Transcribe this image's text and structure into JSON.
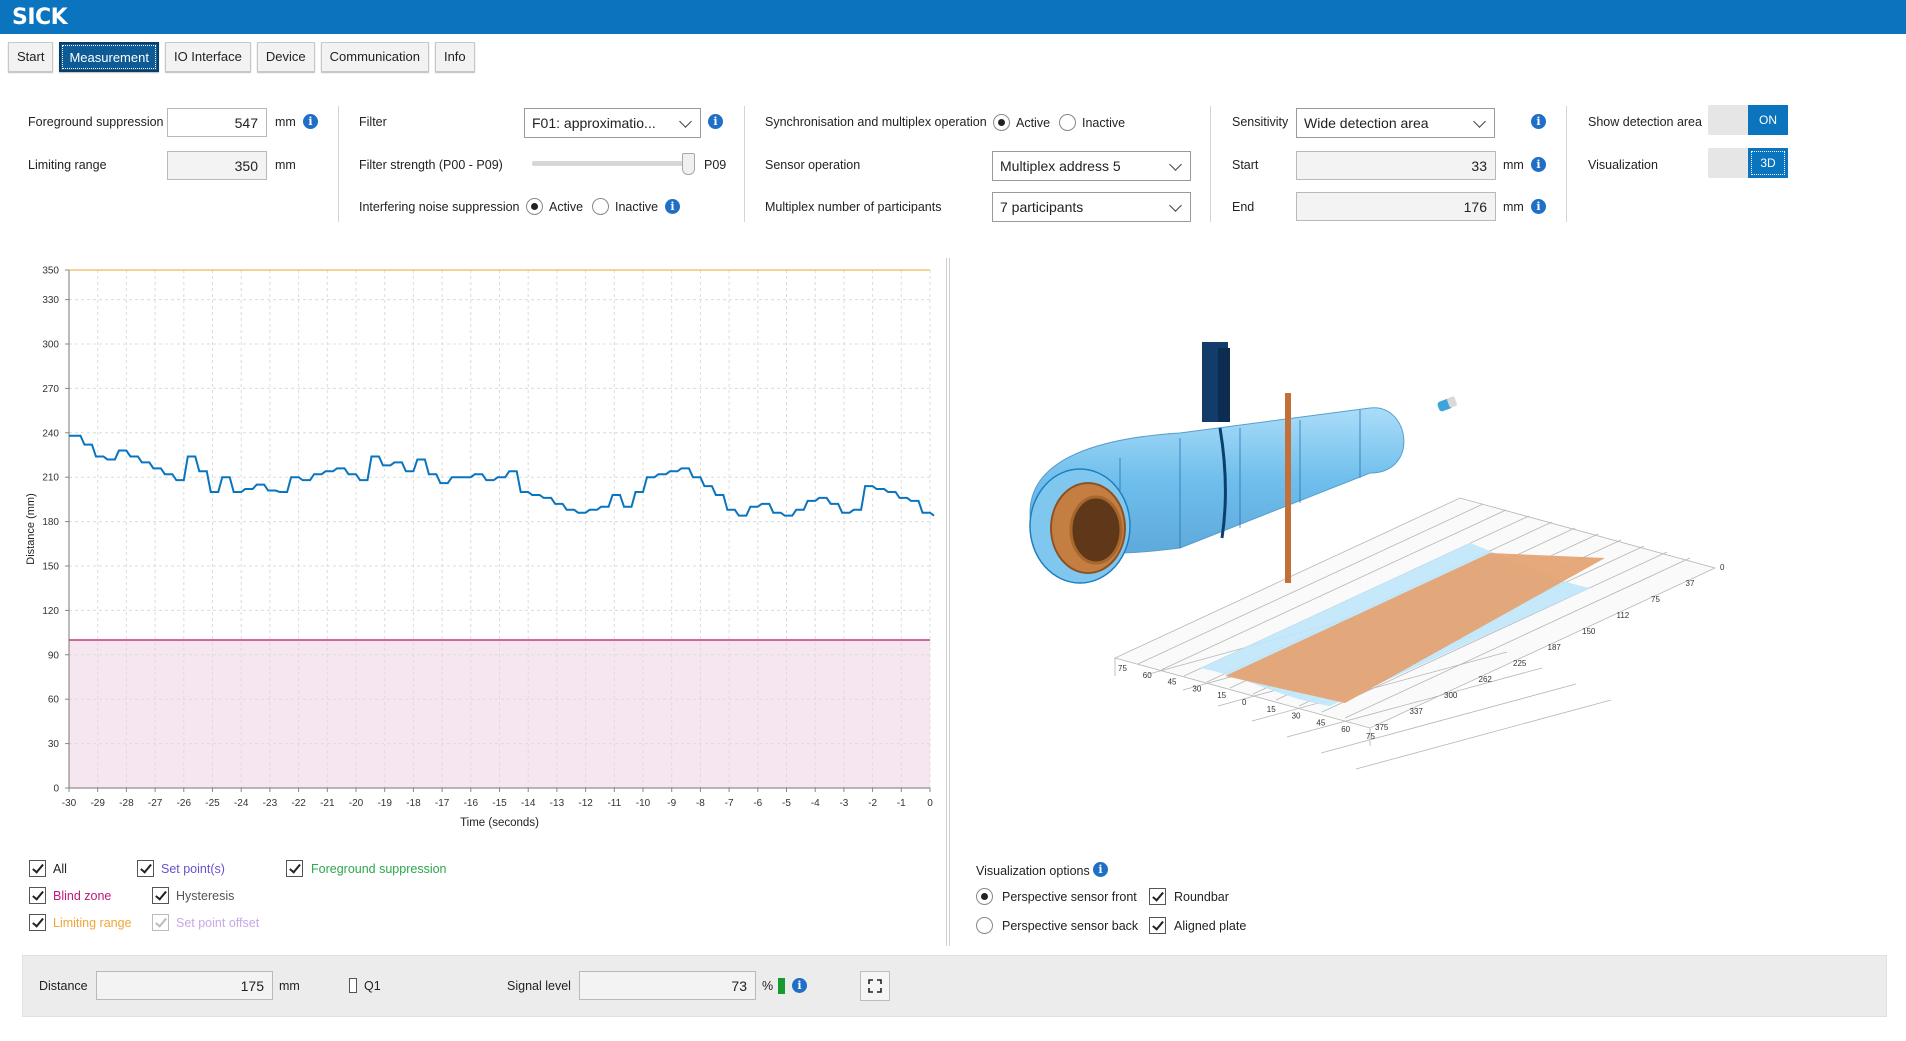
{
  "app": {
    "logo": "SICK"
  },
  "tabs": [
    {
      "label": "Start",
      "active": false
    },
    {
      "label": "Measurement",
      "active": true
    },
    {
      "label": "IO Interface",
      "active": false
    },
    {
      "label": "Device",
      "active": false
    },
    {
      "label": "Communication",
      "active": false
    },
    {
      "label": "Info",
      "active": false
    }
  ],
  "settings": {
    "foreground_suppression": {
      "label": "Foreground suppression",
      "value": "547",
      "unit": "mm"
    },
    "limiting_range": {
      "label": "Limiting range",
      "value": "350",
      "unit": "mm"
    },
    "filter": {
      "label": "Filter",
      "value": "F01: approximatio..."
    },
    "filter_strength": {
      "label": "Filter strength (P00 - P09)",
      "value_label": "P09",
      "level": 1.0
    },
    "interfering_noise": {
      "label": "Interfering noise suppression",
      "active_label": "Active",
      "inactive_label": "Inactive",
      "selected": "Active"
    },
    "sync_multiplex": {
      "label": "Synchronisation and multiplex operation",
      "active_label": "Active",
      "inactive_label": "Inactive",
      "selected": "Active"
    },
    "sensor_operation": {
      "label": "Sensor operation",
      "value": "Multiplex address 5"
    },
    "multiplex_participants": {
      "label": "Multiplex number of participants",
      "value": "7 participants"
    },
    "sensitivity": {
      "label": "Sensitivity",
      "value": "Wide detection area"
    },
    "start": {
      "label": "Start",
      "value": "33",
      "unit": "mm"
    },
    "end": {
      "label": "End",
      "value": "176",
      "unit": "mm"
    },
    "show_detection_area": {
      "label": "Show detection area",
      "value": "ON"
    },
    "visualization": {
      "label": "Visualization",
      "value": "3D"
    }
  },
  "chart_data": {
    "type": "line",
    "xlabel": "Time (seconds)",
    "ylabel": "Distance (mm)",
    "xlim": [
      -30,
      0
    ],
    "ylim": [
      0,
      350
    ],
    "x_ticks": [
      "-30",
      "-29",
      "-28",
      "-27",
      "-26",
      "-25",
      "-24",
      "-23",
      "-22",
      "-21",
      "-20",
      "-19",
      "-18",
      "-17",
      "-16",
      "-15",
      "-14",
      "-13",
      "-12",
      "-11",
      "-10",
      "-9",
      "-8",
      "-7",
      "-6",
      "-5",
      "-4",
      "-3",
      "-2",
      "-1",
      "0"
    ],
    "y_ticks": [
      "0",
      "30",
      "60",
      "90",
      "120",
      "150",
      "180",
      "210",
      "240",
      "270",
      "300",
      "330",
      "350"
    ],
    "grid": true,
    "series": [
      {
        "color": "#0a74bf",
        "x": [
          -30,
          -29.6,
          -29.2,
          -28.8,
          -28.4,
          -28,
          -27.6,
          -27.2,
          -26.8,
          -26.4,
          -26,
          -25.6,
          -25.2,
          -24.8,
          -24.4,
          -24,
          -23.6,
          -23.2,
          -22.8,
          -22.4,
          -22,
          -21.6,
          -21.2,
          -20.8,
          -20.4,
          -20,
          -19.6,
          -19.2,
          -18.8,
          -18.4,
          -18,
          -17.6,
          -17.2,
          -16.8,
          -16.4,
          -16,
          -15.6,
          -15.2,
          -14.8,
          -14.4,
          -14,
          -13.6,
          -13.2,
          -12.8,
          -12.4,
          -12,
          -11.6,
          -11.2,
          -10.8,
          -10.4,
          -10,
          -9.6,
          -9.2,
          -8.8,
          -8.4,
          -8,
          -7.6,
          -7.2,
          -6.8,
          -6.4,
          -6,
          -5.6,
          -5.2,
          -4.8,
          -4.4,
          -4,
          -3.6,
          -3.2,
          -2.8,
          -2.4,
          -2,
          -1.6,
          -1.2,
          -0.8,
          -0.4,
          0
        ],
        "y": [
          238,
          232,
          224,
          222,
          228,
          224,
          220,
          216,
          212,
          208,
          224,
          214,
          200,
          210,
          200,
          202,
          205,
          201,
          200,
          210,
          208,
          212,
          214,
          216,
          212,
          208,
          224,
          218,
          220,
          214,
          222,
          212,
          206,
          210,
          210,
          212,
          208,
          210,
          214,
          200,
          198,
          196,
          192,
          188,
          186,
          188,
          190,
          198,
          190,
          200,
          210,
          212,
          214,
          216,
          210,
          204,
          198,
          188,
          184,
          190,
          192,
          186,
          184,
          188,
          194,
          196,
          192,
          186,
          188,
          204,
          202,
          200,
          196,
          194,
          186,
          184
        ]
      }
    ],
    "reference_lines": [
      {
        "y": 350,
        "color": "#f2a43a"
      },
      {
        "y": 100,
        "color": "#c2387f",
        "fill_below": "#f6e6f0"
      }
    ]
  },
  "legend_checks": [
    {
      "label": "All",
      "color": "#222222",
      "checked": true,
      "enabled": true
    },
    {
      "label": "Set point(s)",
      "color": "#6a4fd1",
      "checked": true,
      "enabled": true
    },
    {
      "label": "Foreground suppression",
      "color": "#2aa84a",
      "checked": true,
      "enabled": true
    },
    {
      "label": "Blind zone",
      "color": "#c2187a",
      "checked": true,
      "enabled": true
    },
    {
      "label": "Hysteresis",
      "color": "#555555",
      "checked": true,
      "enabled": true
    },
    {
      "label": "Limiting range",
      "color": "#f2a43a",
      "checked": true,
      "enabled": true
    },
    {
      "label": "Set point offset",
      "color": "#c9a7e8",
      "checked": true,
      "enabled": false
    }
  ],
  "viz3d": {
    "axis_a_ticks": [
      "75",
      "60",
      "45",
      "30",
      "15",
      "0",
      "15",
      "30",
      "45",
      "60",
      "75"
    ],
    "axis_b_ticks": [
      "0",
      "37",
      "75",
      "112",
      "150",
      "187",
      "225",
      "262",
      "300",
      "337",
      "375"
    ],
    "options_label": "Visualization options",
    "perspective_front": "Perspective sensor front",
    "perspective_back": "Perspective sensor back",
    "perspective_selected": "front",
    "roundbar": {
      "label": "Roundbar",
      "checked": true
    },
    "aligned_plate": {
      "label": "Aligned plate",
      "checked": true
    }
  },
  "status": {
    "distance_label": "Distance",
    "distance_value": "175",
    "distance_unit": "mm",
    "q1_label": "Q1",
    "signal_label": "Signal level",
    "signal_value": "73",
    "signal_unit": "%"
  }
}
